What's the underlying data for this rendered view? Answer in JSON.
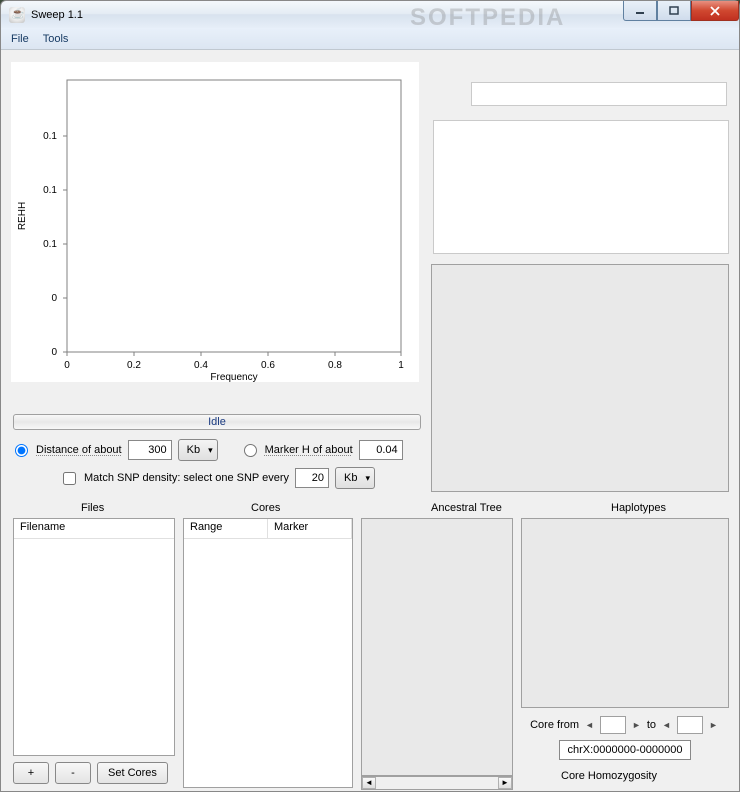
{
  "window": {
    "title": "Sweep 1.1"
  },
  "menu": {
    "file": "File",
    "tools": "Tools"
  },
  "chart_data": {
    "type": "scatter",
    "title": "",
    "xlabel": "Frequency",
    "ylabel": "REHH",
    "xlim": [
      0,
      1
    ],
    "ylim": [
      0,
      0.1
    ],
    "xticks": [
      0,
      0.2,
      0.4,
      0.6,
      0.8,
      1
    ],
    "yticks": [
      0,
      0,
      0.1,
      0.1,
      0.1
    ],
    "series": []
  },
  "progress": {
    "label": "Idle"
  },
  "opts": {
    "distance_label": "Distance of about",
    "distance_value": "300",
    "distance_unit": "Kb",
    "markerh_label": "Marker H of about",
    "markerh_value": "0.04",
    "density_label": "Match SNP density: select one SNP every",
    "density_value": "20",
    "density_unit": "Kb"
  },
  "sections": {
    "files": "Files",
    "cores": "Cores",
    "tree": "Ancestral Tree",
    "hap": "Haplotypes"
  },
  "files": {
    "col": "Filename"
  },
  "cores": {
    "col_range": "Range",
    "col_marker": "Marker"
  },
  "corefrom": {
    "label": "Core from",
    "to": "to"
  },
  "chr": {
    "value": "chrX:0000000-0000000"
  },
  "homo": {
    "label": "Core Homozygosity"
  },
  "buttons": {
    "plus": "+",
    "minus": "-",
    "setcores": "Set Cores"
  }
}
